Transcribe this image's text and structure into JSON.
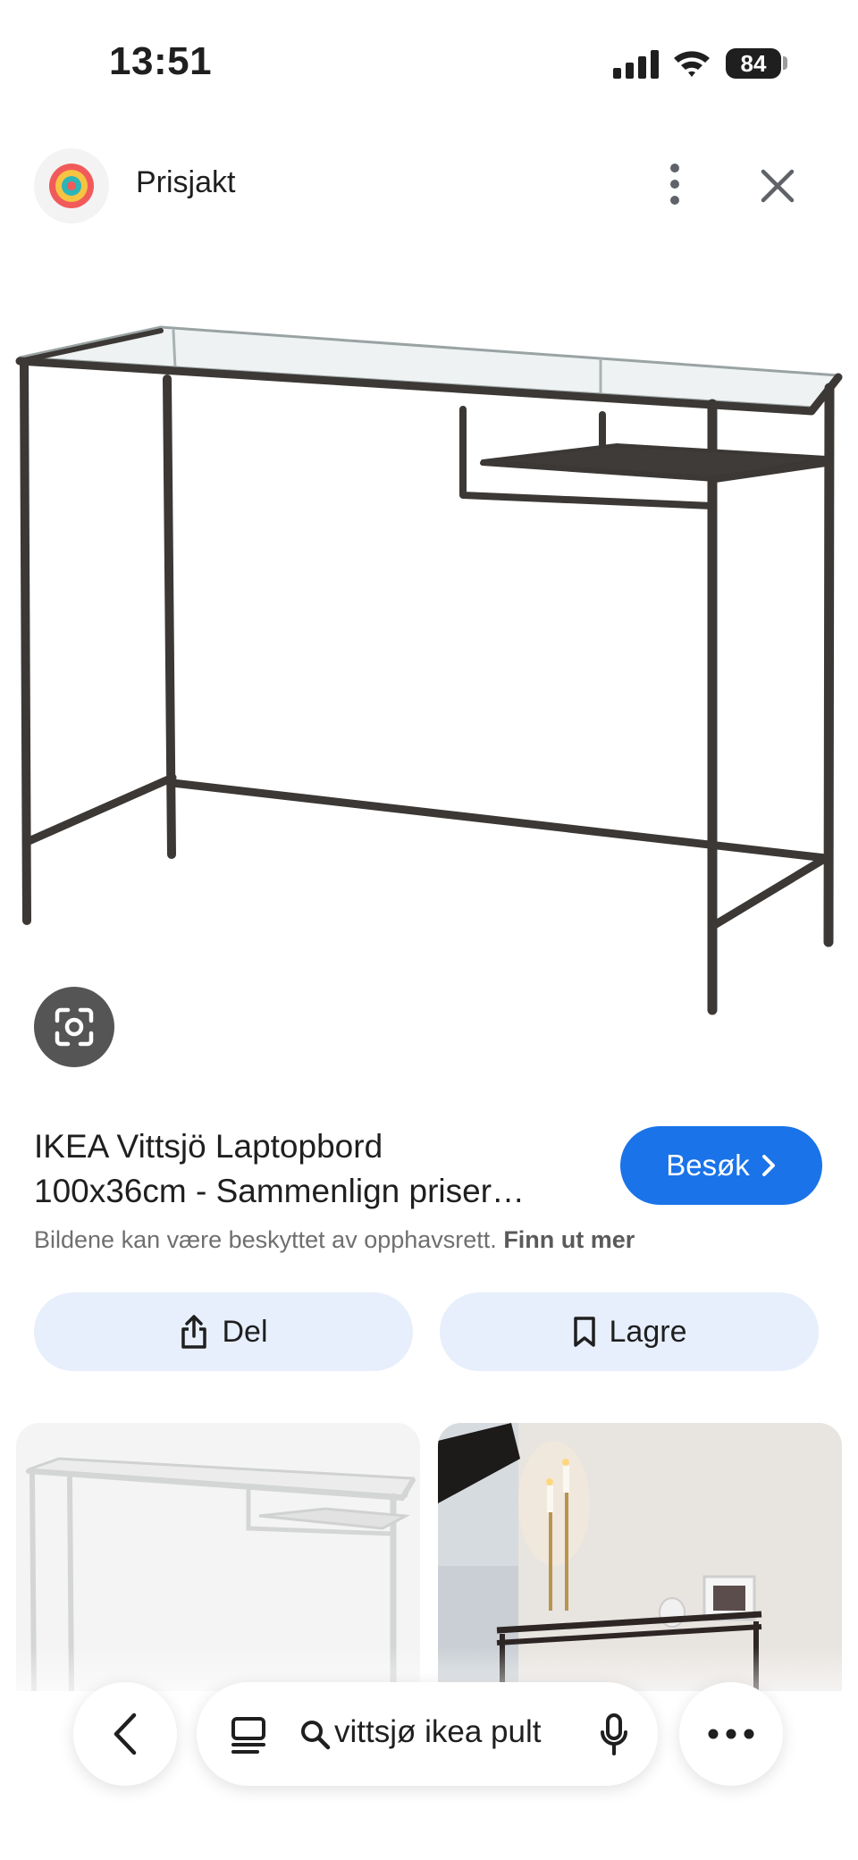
{
  "status_bar": {
    "time": "13:51",
    "battery": "84"
  },
  "source": {
    "name": "Prisjakt"
  },
  "result": {
    "title_line1": "IKEA Vittsjö Laptopbord",
    "title_line2": "100x36cm - Sammenlign priser…",
    "visit_label": "Besøk",
    "copyright_text": "Bildene kan være beskyttet av opphavsrett.",
    "learn_more": "Finn ut mer"
  },
  "actions": {
    "share_label": "Del",
    "save_label": "Lagre"
  },
  "bottom_bar": {
    "query": "vittsjø ikea pult"
  },
  "colors": {
    "accent_blue": "#1a73e8",
    "pill_bg": "#e7eefc",
    "desk_frame": "#3b3835"
  },
  "icons": [
    "signal-icon",
    "wifi-icon",
    "battery-icon",
    "prisjakt-logo",
    "more-vert-icon",
    "close-icon",
    "google-lens-icon",
    "chevron-right-icon",
    "share-icon",
    "bookmark-icon",
    "back-icon",
    "tabs-icon",
    "search-icon",
    "mic-icon",
    "more-horiz-icon"
  ]
}
